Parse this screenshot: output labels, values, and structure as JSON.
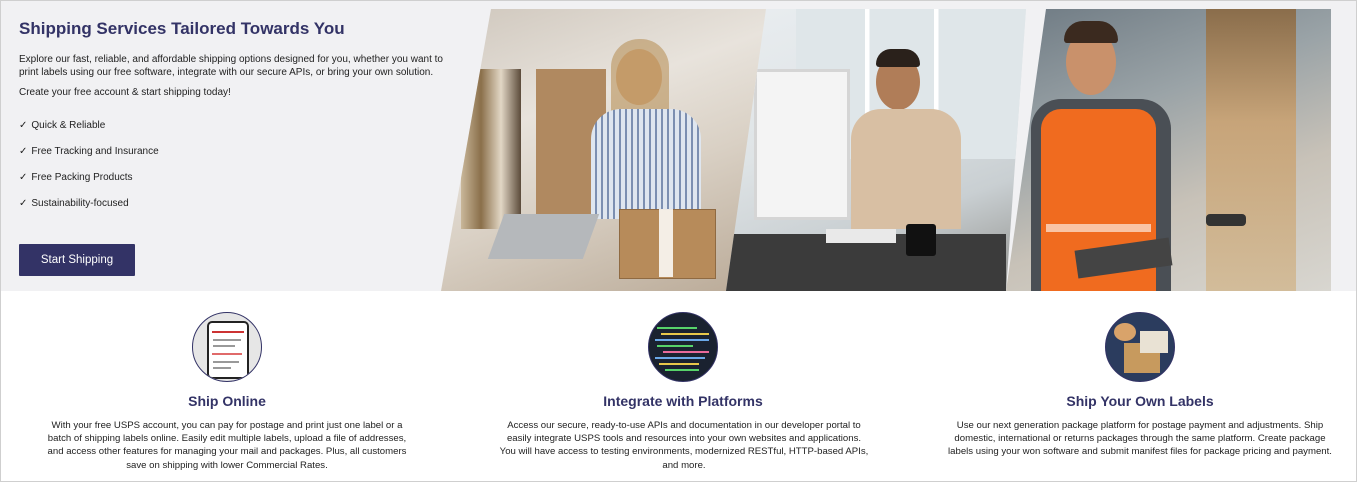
{
  "hero": {
    "title": "Shipping Services Tailored Towards You",
    "description": "Explore our fast, reliable, and affordable shipping options designed for you, whether you want to print labels using our free software, integrate with our secure APIs, or bring your own solution.",
    "cta_text": "Create your free account & start shipping today!",
    "features": [
      "Quick & Reliable",
      "Free Tracking and Insurance",
      "Free Packing Products",
      "Sustainability-focused"
    ],
    "check_glyph": "✓",
    "button_label": "Start Shipping"
  },
  "cards": [
    {
      "title": "Ship Online",
      "icon": "phone-icon",
      "description": "With your free USPS account, you can pay for postage and print just one label or a batch of shipping labels online. Easily edit multiple labels, upload a file of addresses, and access other features for managing your mail and packages. Plus, all customers save on shipping with lower Commercial Rates."
    },
    {
      "title": "Integrate with Platforms",
      "icon": "code-icon",
      "description": "Access our secure, ready-to-use APIs and documentation in our developer portal to easily integrate USPS tools and resources into your own websites and applications. You will have access to testing environments, modernized RESTful, HTTP-based APIs, and more."
    },
    {
      "title": "Ship Your Own Labels",
      "icon": "package-icon",
      "description": "Use our next generation package platform for postage payment and adjustments. Ship domestic, international or returns packages through the same platform. Create package labels using your won software and submit manifest files for package pricing and payment."
    }
  ],
  "colors": {
    "brand_navy": "#333366",
    "hero_bg": "#f1f1f3"
  }
}
